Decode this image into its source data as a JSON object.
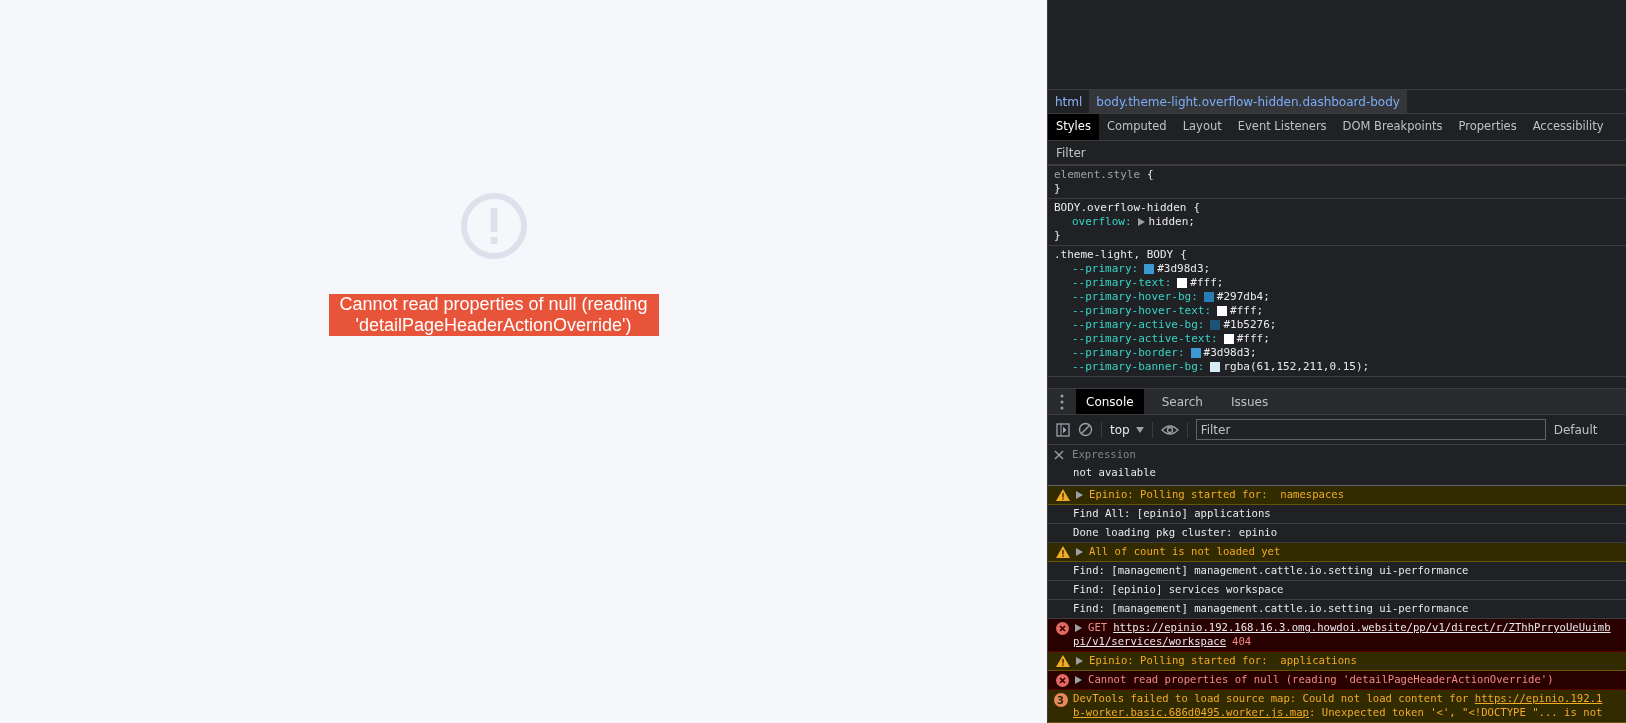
{
  "page": {
    "error_message": "Cannot read properties of null (reading 'detailPageHeaderActionOverride')"
  },
  "devtools": {
    "breadcrumbs": [
      {
        "label": "html",
        "selected": false
      },
      {
        "label": "body.theme-light.overflow-hidden.dashboard-body",
        "selected": true
      }
    ],
    "styles_tabs": [
      {
        "label": "Styles",
        "selected": true
      },
      {
        "label": "Computed",
        "selected": false
      },
      {
        "label": "Layout",
        "selected": false
      },
      {
        "label": "Event Listeners",
        "selected": false
      },
      {
        "label": "DOM Breakpoints",
        "selected": false
      },
      {
        "label": "Properties",
        "selected": false
      },
      {
        "label": "Accessibility",
        "selected": false
      }
    ],
    "styles_filter": {
      "placeholder": "Filter"
    },
    "rules": [
      {
        "selector": "element.style",
        "inline": true,
        "open": "{",
        "close": "}"
      },
      {
        "selector": "BODY.overflow-hidden",
        "inline": false,
        "open": "{",
        "close": "}",
        "declarations": [
          {
            "property": "overflow:",
            "value": "hidden;",
            "expandable": true
          }
        ]
      },
      {
        "selector": ".theme-light, BODY",
        "inline": false,
        "open": "{",
        "declarations": [
          {
            "property": "--primary:",
            "value": "#3d98d3;",
            "color": "#3d98d3"
          },
          {
            "property": "--primary-text:",
            "value": "#fff;",
            "color": "#ffffff"
          },
          {
            "property": "--primary-hover-bg:",
            "value": "#297db4;",
            "color": "#297db4"
          },
          {
            "property": "--primary-hover-text:",
            "value": "#fff;",
            "color": "#ffffff"
          },
          {
            "property": "--primary-active-bg:",
            "value": "#1b5276;",
            "color": "#1b5276"
          },
          {
            "property": "--primary-active-text:",
            "value": "#fff;",
            "color": "#ffffff"
          },
          {
            "property": "--primary-border:",
            "value": "#3d98d3;",
            "color": "#3d98d3"
          },
          {
            "property": "--primary-banner-bg:",
            "value": "rgba(61,152,211,0.15);",
            "color": "#d8eaf6"
          }
        ]
      }
    ],
    "drawer_tabs": [
      {
        "label": "Console",
        "selected": true
      },
      {
        "label": "Search",
        "selected": false
      },
      {
        "label": "Issues",
        "selected": false
      }
    ],
    "console_toolbar": {
      "context": "top",
      "filter": {
        "placeholder": "Filter"
      },
      "levels": "Default"
    },
    "live_expression": {
      "placeholder": "Expression",
      "result": "not available"
    },
    "messages": [
      {
        "kind": "warning",
        "expandable": true,
        "text": "Epinio: Polling started for:  namespaces"
      },
      {
        "kind": "log",
        "text": "Find All: [epinio] applications"
      },
      {
        "kind": "log",
        "text": "Done loading pkg cluster: epinio"
      },
      {
        "kind": "warning",
        "expandable": true,
        "text": "All of count is not loaded yet"
      },
      {
        "kind": "log",
        "text": "Find: [management] management.cattle.io.setting ui-performance"
      },
      {
        "kind": "log",
        "text": "Find: [epinio] services workspace"
      },
      {
        "kind": "log",
        "text": "Find: [management] management.cattle.io.setting ui-performance"
      },
      {
        "kind": "network_error",
        "expandable": true,
        "method": "GET",
        "url_lines": [
          "https://epinio.192.168.16.3.omg.howdoi.website/pp/v1/direct/r/ZThhPrryoUeUuimb",
          "pi/v1/services/workspace"
        ],
        "status": "404"
      },
      {
        "kind": "warning",
        "expandable": true,
        "text": "Epinio: Polling started for:  applications"
      },
      {
        "kind": "error",
        "expandable": true,
        "text": "Cannot read properties of null (reading 'detailPageHeaderActionOverride')"
      },
      {
        "kind": "issue",
        "count": "3",
        "lines": [
          [
            {
              "text": "DevTools failed to load source map: Could not load content for ",
              "link": false
            },
            {
              "text": "https://epinio.192.1",
              "link": true
            }
          ],
          [
            {
              "text": "b-worker.basic.686d0495.worker.js.map",
              "link": true
            },
            {
              "text": ": Unexpected token '<', \"<!DOCTYPE \"... is not",
              "link": false
            }
          ]
        ]
      }
    ]
  }
}
